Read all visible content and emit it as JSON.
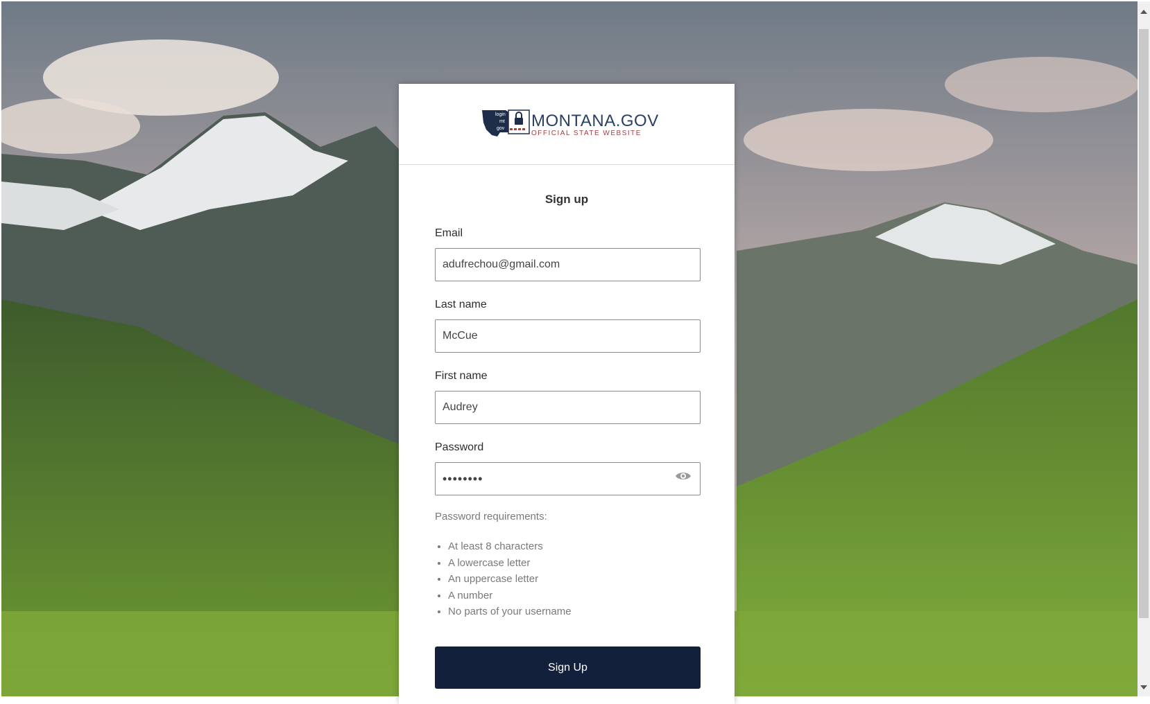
{
  "logo": {
    "mark_text": [
      "login",
      "mt",
      "gov"
    ],
    "title": "MONTANA.GOV",
    "subtitle": "OFFICIAL STATE WEBSITE"
  },
  "form": {
    "title": "Sign up",
    "email": {
      "label": "Email",
      "value": "adufrechou@gmail.com"
    },
    "last_name": {
      "label": "Last name",
      "value": "McCue"
    },
    "first_name": {
      "label": "First name",
      "value": "Audrey"
    },
    "password": {
      "label": "Password",
      "value": "••••••••",
      "toggle_icon": "eye-icon"
    },
    "requirements_title": "Password requirements:",
    "requirements": [
      "At least 8 characters",
      "A lowercase letter",
      "An uppercase letter",
      "A number",
      "No parts of your username"
    ],
    "submit_label": "Sign Up"
  },
  "colors": {
    "button": "#13203b",
    "logo_text": "#2b3f63",
    "logo_subtitle": "#a04040"
  }
}
